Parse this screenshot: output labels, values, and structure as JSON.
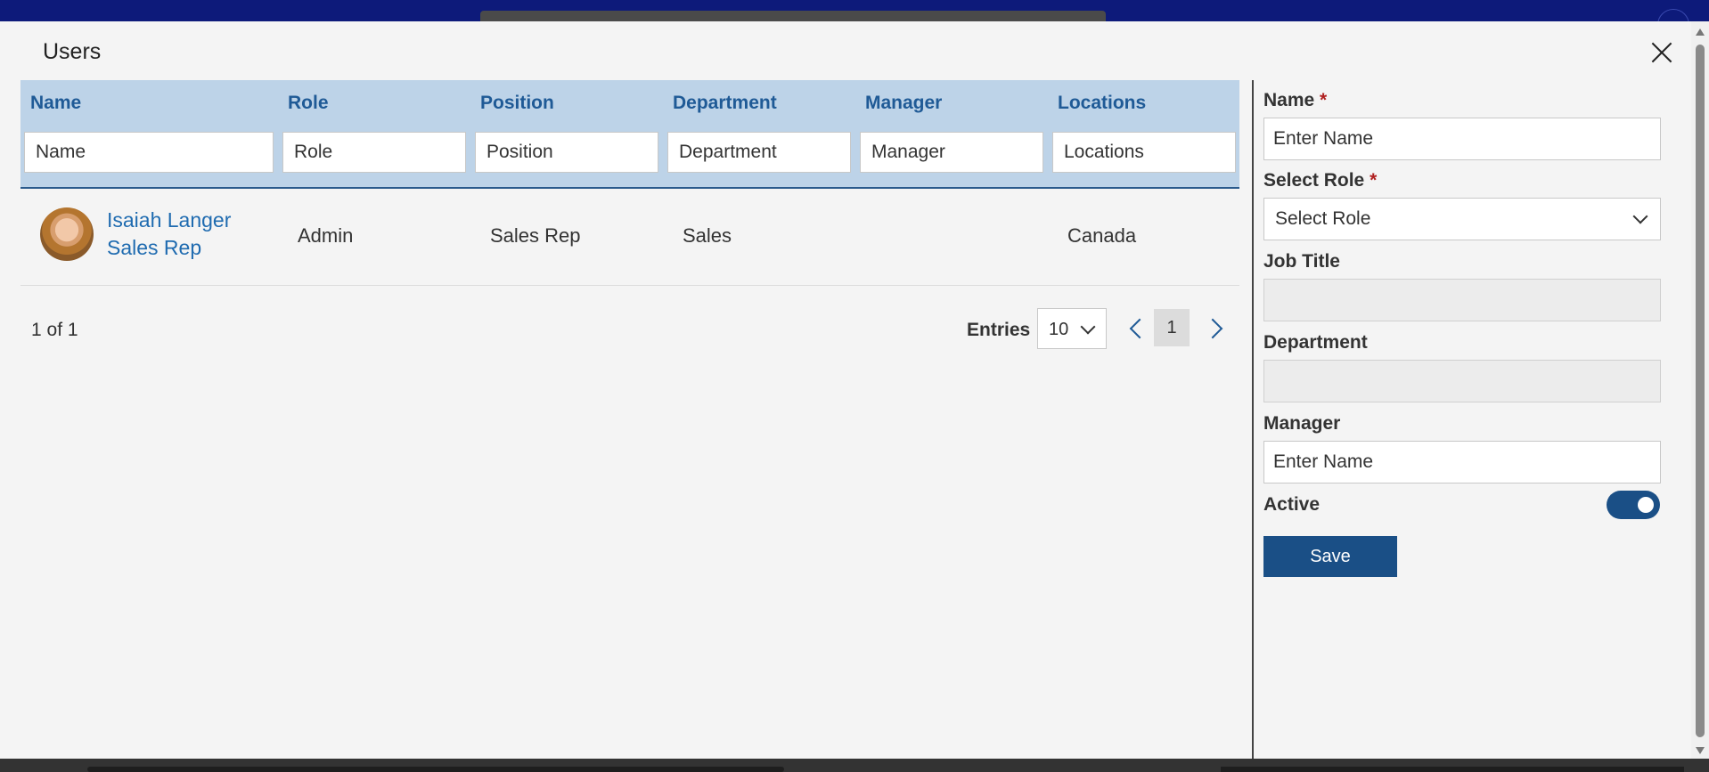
{
  "modal": {
    "title": "Users"
  },
  "grid": {
    "columns": [
      {
        "label": "Name",
        "filter_placeholder": "Name"
      },
      {
        "label": "Role",
        "filter_placeholder": "Role"
      },
      {
        "label": "Position",
        "filter_placeholder": "Position"
      },
      {
        "label": "Department",
        "filter_placeholder": "Department"
      },
      {
        "label": "Manager",
        "filter_placeholder": "Manager"
      },
      {
        "label": "Locations",
        "filter_placeholder": "Locations"
      }
    ],
    "rows": [
      {
        "name": "Isaiah Langer",
        "subtitle": "Sales Rep",
        "role": "Admin",
        "position": "Sales Rep",
        "department": "Sales",
        "manager": "",
        "locations": "Canada"
      }
    ]
  },
  "pager": {
    "count_text": "1 of 1",
    "entries_label": "Entries",
    "entries_value": "10",
    "current_page": "1"
  },
  "form": {
    "name_label": "Name",
    "name_placeholder": "Enter Name",
    "role_label": "Select Role",
    "role_placeholder": "Select Role",
    "job_title_label": "Job Title",
    "department_label": "Department",
    "manager_label": "Manager",
    "manager_placeholder": "Enter Name",
    "active_label": "Active",
    "active": true,
    "save_label": "Save",
    "required_mark": "*"
  },
  "colors": {
    "accent": "#1a4f86",
    "header_bg": "#bdd3e8",
    "link": "#1f6bb0",
    "required": "#b02020"
  }
}
